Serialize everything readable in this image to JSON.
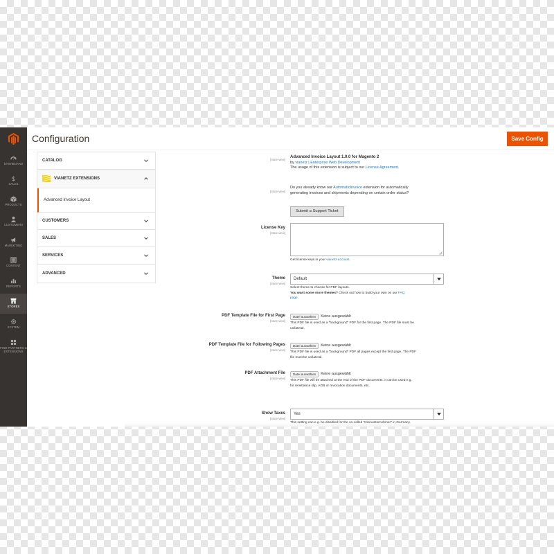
{
  "admin_menu": {
    "items": [
      {
        "label": "DASHBOARD",
        "icon": "dashboard-icon"
      },
      {
        "label": "SALES",
        "icon": "dollar-icon"
      },
      {
        "label": "PRODUCTS",
        "icon": "cube-icon"
      },
      {
        "label": "CUSTOMERS",
        "icon": "customers-icon"
      },
      {
        "label": "MARKETING",
        "icon": "megaphone-icon"
      },
      {
        "label": "CONTENT",
        "icon": "content-icon"
      },
      {
        "label": "REPORTS",
        "icon": "bar-chart-icon"
      },
      {
        "label": "STORES",
        "icon": "store-icon"
      },
      {
        "label": "SYSTEM",
        "icon": "gear-icon"
      },
      {
        "label": "FIND PARTNERS & EXTENSIONS",
        "icon": "partners-icon"
      }
    ],
    "active": "STORES",
    "bg_color": "#373330"
  },
  "header": {
    "title": "Configuration",
    "save_label": "Save Config",
    "accent": "#eb5202"
  },
  "tabs": {
    "catalog": "CATALOG",
    "vianetz": "VIANETZ EXTENSIONS",
    "vianetz_sub": "Advanced Invoice Layout",
    "customers": "CUSTOMERS",
    "sales": "SALES",
    "services": "SERVICES",
    "advanced": "ADVANCED"
  },
  "form": {
    "scope": "[store view]",
    "intro": {
      "title": "Advanced Invoice Layout 1.0.0 for Magento 2",
      "by_prefix": "by ",
      "by_link": "vianetz | Enterprise Web Development",
      "usage_prefix": "The usage of this extension is subject to our ",
      "usage_link": "License Agreement",
      "usage_suffix": "."
    },
    "automatic": {
      "text_a": "Do you already know our ",
      "link": "AutomaticInvoice",
      "text_b": " extension for automatically",
      "line2": "generating invoices and shipments depending on certain order status?",
      "button": "Submit a Support Ticket"
    },
    "license": {
      "label": "License Key",
      "note_prefix": "Get license keys in your ",
      "note_link": "vianetz account",
      "note_suffix": "."
    },
    "theme": {
      "label": "Theme",
      "value": "Default",
      "note1": "Select theme to choose for PDF layouts.",
      "note2_bold": "You want some more themes?",
      "note2_text": " Check out how to build your own on our ",
      "note2_link": "FAQ",
      "note3_link": "page",
      "note3_suffix": "."
    },
    "pdf_first": {
      "label": "PDF Template File for First Page",
      "button": "Datei auswählen",
      "none": "Keine ausgewählt",
      "note1": "This PDF file is used as a \"background\" PDF for the first page. The PDF file must be",
      "note2": "unilateral."
    },
    "pdf_following": {
      "label": "PDF Template File for Following Pages",
      "button": "Datei auswählen",
      "none": "Keine ausgewählt",
      "note1": "This PDF file is used as a \"background\" PDF all pages except the first page. The PDF",
      "note2": "file must be unilateral."
    },
    "pdf_attachment": {
      "label": "PDF Attachment File",
      "button": "Datei auswählen",
      "none": "Keine ausgewählt",
      "note1": "This PDF file will be attached at the end of the PDF documents. It can be used e.g.",
      "note2": "for remittance slip, AGB or revocation documents, etc."
    },
    "show_taxes": {
      "label": "Show Taxes",
      "value": "Yes",
      "note1": "This setting can e.g. be disabled for the so-called \"Kleinunternehmer\" in Germany."
    }
  }
}
